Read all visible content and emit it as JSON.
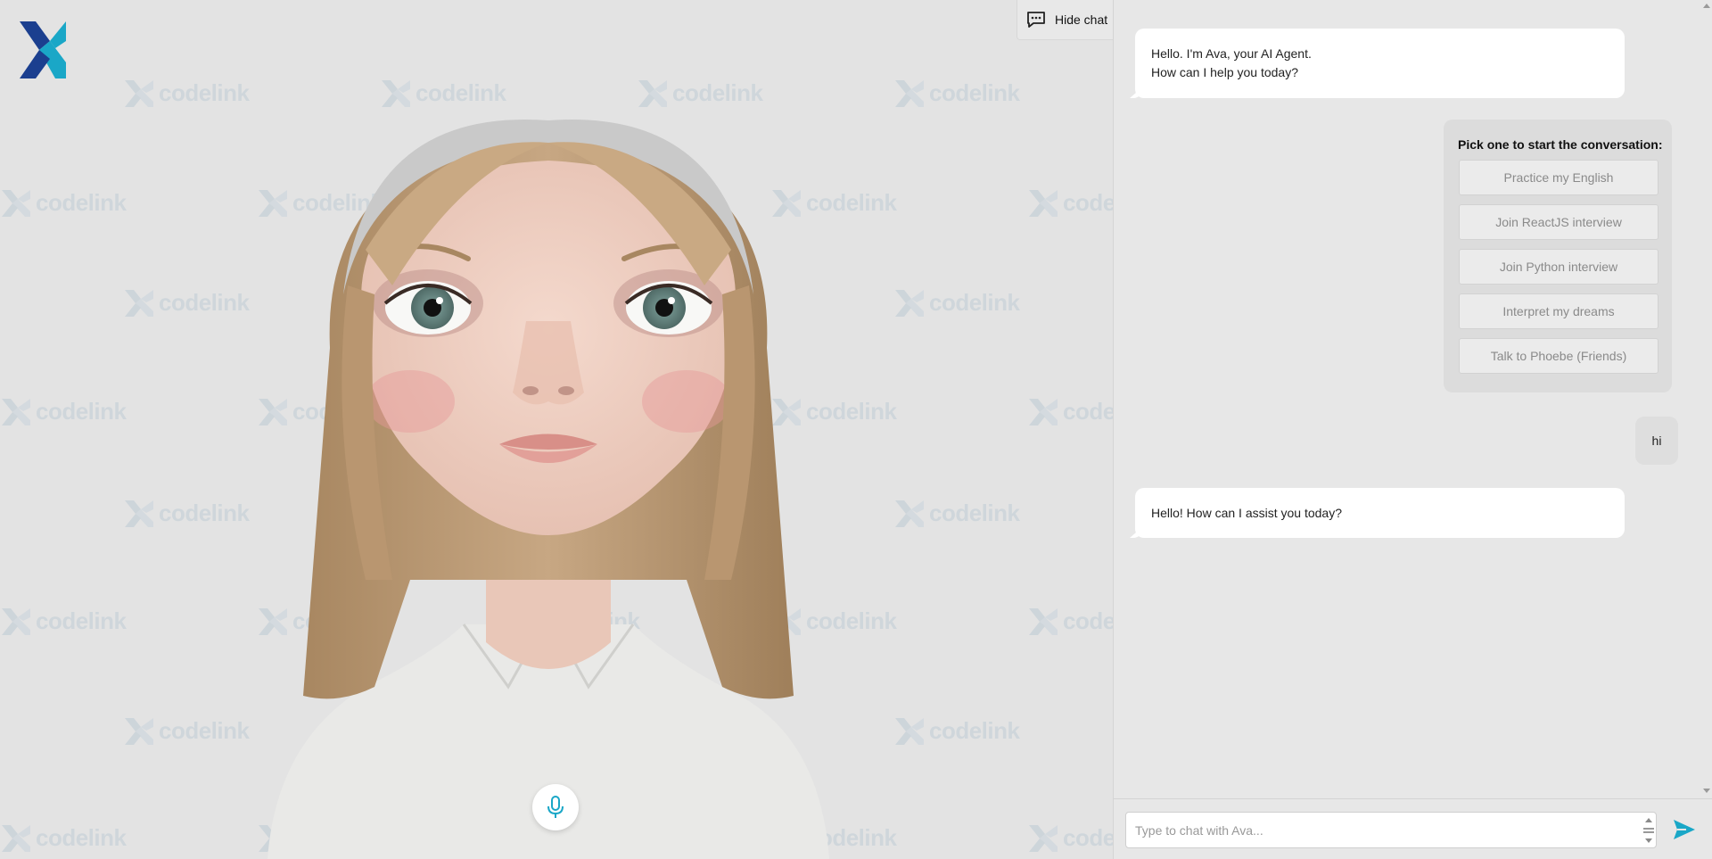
{
  "brand": {
    "watermark_text": "codelink",
    "logo_colors": [
      "#1b3f8f",
      "#1aa7c7"
    ]
  },
  "header": {
    "hide_chat_label": "Hide chat",
    "hide_chat_icon": "chat-bubble-icon"
  },
  "avatar": {
    "description_icon": "avatar-3d-character"
  },
  "controls": {
    "mic_icon": "microphone-icon",
    "accent_color": "#1aa7c7"
  },
  "chat": {
    "messages": [
      {
        "role": "assistant",
        "lines": [
          "Hello. I'm Ava, your AI Agent.",
          "How can I help you today?"
        ]
      },
      {
        "role": "assistant",
        "type": "suggestions",
        "title": "Pick one to start the conversation:",
        "options": [
          "Practice my English",
          "Join ReactJS interview",
          "Join Python interview",
          "Interpret my dreams",
          "Talk to Phoebe (Friends)"
        ]
      },
      {
        "role": "user",
        "text": "hi"
      },
      {
        "role": "assistant",
        "text": "Hello! How can I assist you today?"
      }
    ],
    "input": {
      "value": "",
      "placeholder": "Type to chat with Ava..."
    },
    "send_icon": "send-icon"
  }
}
